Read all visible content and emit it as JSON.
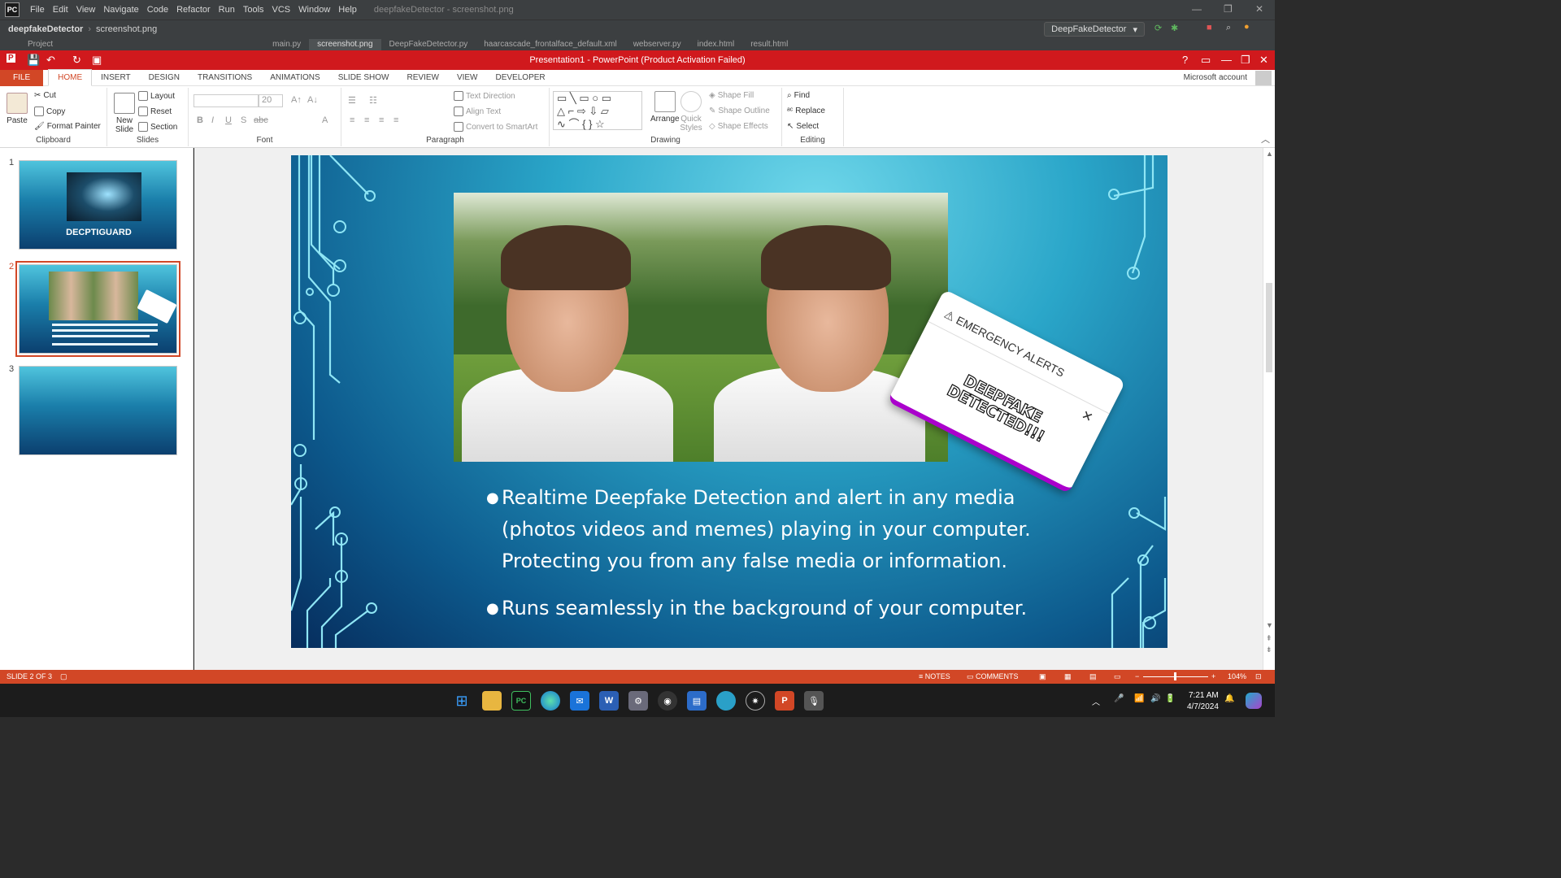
{
  "ide": {
    "logo": "PC",
    "menu": [
      "File",
      "Edit",
      "View",
      "Navigate",
      "Code",
      "Refactor",
      "Run",
      "Tools",
      "VCS",
      "Window",
      "Help"
    ],
    "window_title": "deepfakeDetector - screenshot.png",
    "project_name": "deepfakeDetector",
    "current_file": "screenshot.png",
    "run_config": "DeepFakeDetector",
    "tabs": [
      "Project",
      "main.py",
      "screenshot.png",
      "DeepFakeDetector.py",
      "haarcascade_frontalface_default.xml",
      "webserver.py",
      "index.html",
      "result.html"
    ],
    "active_tab": "screenshot.png"
  },
  "ppt": {
    "title": "Presentation1 -  PowerPoint (Product Activation Failed)",
    "tabs": [
      "FILE",
      "HOME",
      "INSERT",
      "DESIGN",
      "TRANSITIONS",
      "ANIMATIONS",
      "SLIDE SHOW",
      "REVIEW",
      "VIEW",
      "DEVELOPER"
    ],
    "active_tab": "HOME",
    "account": "Microsoft account",
    "ribbon": {
      "clipboard": {
        "paste": "Paste",
        "cut": "Cut",
        "copy": "Copy",
        "format_painter": "Format Painter",
        "label": "Clipboard"
      },
      "slides": {
        "new_slide": "New Slide",
        "layout": "Layout",
        "reset": "Reset",
        "section": "Section",
        "label": "Slides"
      },
      "font": {
        "size": "20",
        "label": "Font"
      },
      "paragraph": {
        "text_direction": "Text Direction",
        "align_text": "Align Text",
        "convert_smartart": "Convert to SmartArt",
        "label": "Paragraph"
      },
      "drawing": {
        "arrange": "Arrange",
        "quick_styles": "Quick Styles",
        "shape_fill": "Shape Fill",
        "shape_outline": "Shape Outline",
        "shape_effects": "Shape Effects",
        "label": "Drawing"
      },
      "editing": {
        "find": "Find",
        "replace": "Replace",
        "select": "Select",
        "label": "Editing"
      }
    },
    "thumbnails": [
      {
        "num": "1",
        "title": "DECPTIGUARD"
      },
      {
        "num": "2",
        "title": ""
      },
      {
        "num": "3",
        "title": ""
      }
    ],
    "slide": {
      "alert_header": "EMERGENCY ALERTS",
      "alert_message": "DEEPFAKE DETECTED!!!",
      "bullet1_line1": "Realtime Deepfake Detection and alert in any media",
      "bullet1_line2": "(photos videos and memes) playing in your computer.",
      "bullet1_line3": "Protecting you from any false media or information.",
      "bullet2": "Runs seamlessly in the background of your computer."
    },
    "status": {
      "slide": "SLIDE 2 OF 3",
      "notes": "NOTES",
      "comments": "COMMENTS",
      "zoom": "104%"
    }
  },
  "taskbar": {
    "time": "7:21 AM",
    "date": "4/7/2024"
  },
  "colors": {
    "ppt_red": "#d24726",
    "title_red": "#d0191d",
    "ide_bg": "#3c3f41"
  }
}
